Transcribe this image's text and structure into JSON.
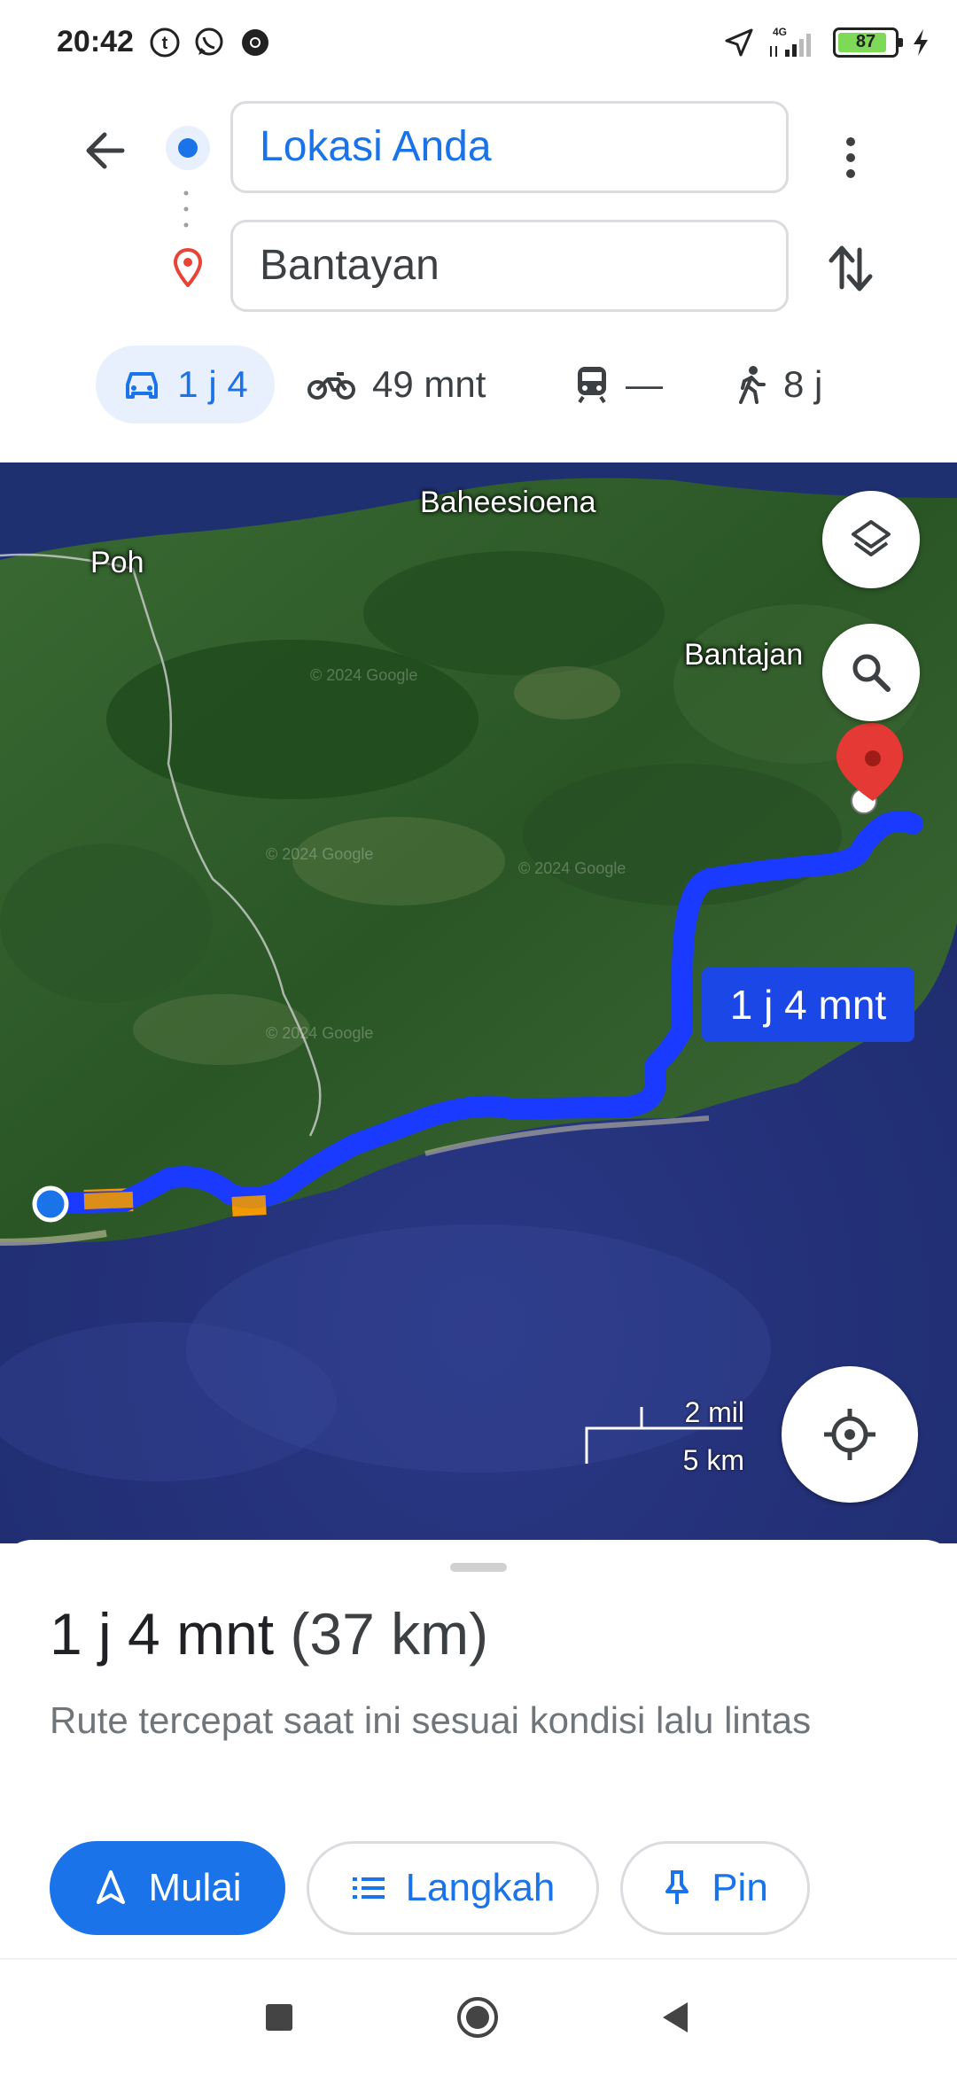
{
  "status_bar": {
    "time": "20:42",
    "notification_icons": [
      "tumblr-icon",
      "whatsapp-icon",
      "chrome-icon"
    ],
    "network": "4G",
    "battery_percent": "87",
    "battery_level": 0.87
  },
  "directions": {
    "origin": "Lokasi Anda",
    "destination": "Bantayan"
  },
  "modes": {
    "car": "1 j 4",
    "motorcycle": "49 mnt",
    "transit": "—",
    "walk": "8 j"
  },
  "map": {
    "labels": {
      "baheesioena": "Baheesioena",
      "poh": "Poh",
      "bantajan": "Bantajan"
    },
    "route_eta": "1 j 4 mnt",
    "scale_imperial": "2 mil",
    "scale_metric": "5 km",
    "watermarks": [
      "© 2024 Google",
      "© 2024 Google",
      "© 2024 Google",
      "© 2024 Google"
    ],
    "colors": {
      "route": "#1a3bff",
      "traffic": "#f29900",
      "water": "#23307a",
      "land": "#2e5a2a"
    }
  },
  "sheet": {
    "duration": "1 j 4 mnt",
    "distance": "(37 km)",
    "subtitle": "Rute tercepat saat ini sesuai kondisi lalu lintas",
    "start_label": "Mulai",
    "steps_label": "Langkah",
    "pin_label": "Pin"
  }
}
